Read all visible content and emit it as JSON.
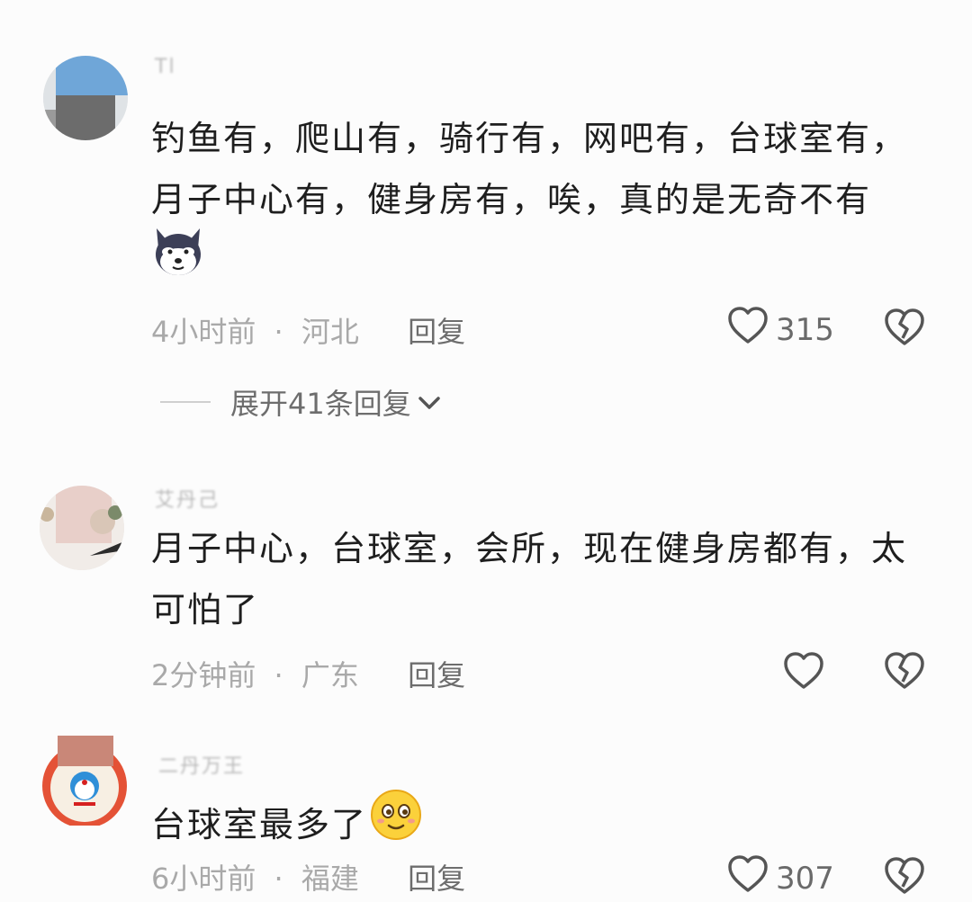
{
  "comments": [
    {
      "username": "Tl",
      "text_line1": "钓鱼有，爬山有，骑行有，网吧有，台球室有，",
      "text_line2": "月子中心有，健身房有，唉，真的是无奇不有",
      "emoji": "dog-emoji",
      "time": "4小时前",
      "location": "河北",
      "reply_label": "回复",
      "likes": "315",
      "expand_label": "展开41条回复"
    },
    {
      "username": "艾丹己",
      "text_line1": "月子中心，台球室，会所，现在健身房都有，太",
      "text_line2": "可怕了",
      "time": "2分钟前",
      "location": "广东",
      "reply_label": "回复"
    },
    {
      "username": "二丹万王",
      "text": "台球室最多了",
      "emoji": "smile-emoji",
      "time": "6小时前",
      "location": "福建",
      "reply_label": "回复",
      "likes": "307"
    }
  ],
  "separator": "·",
  "icons": {
    "like": "heart-outline-icon",
    "dislike": "broken-heart-icon",
    "expand": "chevron-down-icon"
  },
  "colors": {
    "text": "#1e1e1e",
    "meta": "#a9a9a9",
    "action": "#6d6d6d",
    "background": "#fcfcfc"
  }
}
